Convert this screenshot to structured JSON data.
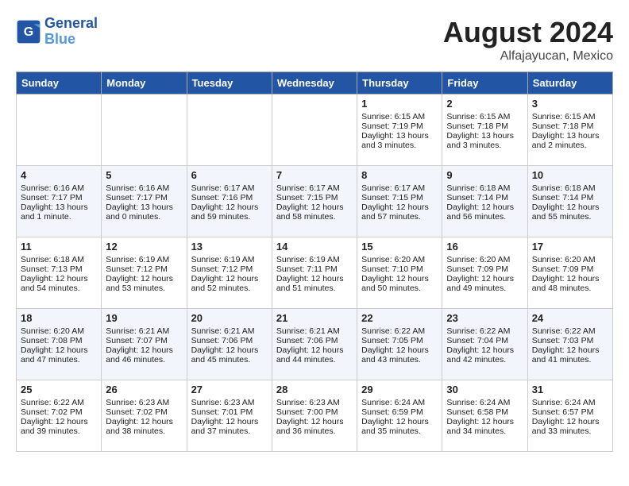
{
  "header": {
    "logo_line1": "General",
    "logo_line2": "Blue",
    "main_title": "August 2024",
    "subtitle": "Alfajayucan, Mexico"
  },
  "days_of_week": [
    "Sunday",
    "Monday",
    "Tuesday",
    "Wednesday",
    "Thursday",
    "Friday",
    "Saturday"
  ],
  "weeks": [
    [
      {
        "day": "",
        "info": ""
      },
      {
        "day": "",
        "info": ""
      },
      {
        "day": "",
        "info": ""
      },
      {
        "day": "",
        "info": ""
      },
      {
        "day": "1",
        "info": "Sunrise: 6:15 AM\nSunset: 7:19 PM\nDaylight: 13 hours\nand 3 minutes."
      },
      {
        "day": "2",
        "info": "Sunrise: 6:15 AM\nSunset: 7:18 PM\nDaylight: 13 hours\nand 3 minutes."
      },
      {
        "day": "3",
        "info": "Sunrise: 6:15 AM\nSunset: 7:18 PM\nDaylight: 13 hours\nand 2 minutes."
      }
    ],
    [
      {
        "day": "4",
        "info": "Sunrise: 6:16 AM\nSunset: 7:17 PM\nDaylight: 13 hours\nand 1 minute."
      },
      {
        "day": "5",
        "info": "Sunrise: 6:16 AM\nSunset: 7:17 PM\nDaylight: 13 hours\nand 0 minutes."
      },
      {
        "day": "6",
        "info": "Sunrise: 6:17 AM\nSunset: 7:16 PM\nDaylight: 12 hours\nand 59 minutes."
      },
      {
        "day": "7",
        "info": "Sunrise: 6:17 AM\nSunset: 7:15 PM\nDaylight: 12 hours\nand 58 minutes."
      },
      {
        "day": "8",
        "info": "Sunrise: 6:17 AM\nSunset: 7:15 PM\nDaylight: 12 hours\nand 57 minutes."
      },
      {
        "day": "9",
        "info": "Sunrise: 6:18 AM\nSunset: 7:14 PM\nDaylight: 12 hours\nand 56 minutes."
      },
      {
        "day": "10",
        "info": "Sunrise: 6:18 AM\nSunset: 7:14 PM\nDaylight: 12 hours\nand 55 minutes."
      }
    ],
    [
      {
        "day": "11",
        "info": "Sunrise: 6:18 AM\nSunset: 7:13 PM\nDaylight: 12 hours\nand 54 minutes."
      },
      {
        "day": "12",
        "info": "Sunrise: 6:19 AM\nSunset: 7:12 PM\nDaylight: 12 hours\nand 53 minutes."
      },
      {
        "day": "13",
        "info": "Sunrise: 6:19 AM\nSunset: 7:12 PM\nDaylight: 12 hours\nand 52 minutes."
      },
      {
        "day": "14",
        "info": "Sunrise: 6:19 AM\nSunset: 7:11 PM\nDaylight: 12 hours\nand 51 minutes."
      },
      {
        "day": "15",
        "info": "Sunrise: 6:20 AM\nSunset: 7:10 PM\nDaylight: 12 hours\nand 50 minutes."
      },
      {
        "day": "16",
        "info": "Sunrise: 6:20 AM\nSunset: 7:09 PM\nDaylight: 12 hours\nand 49 minutes."
      },
      {
        "day": "17",
        "info": "Sunrise: 6:20 AM\nSunset: 7:09 PM\nDaylight: 12 hours\nand 48 minutes."
      }
    ],
    [
      {
        "day": "18",
        "info": "Sunrise: 6:20 AM\nSunset: 7:08 PM\nDaylight: 12 hours\nand 47 minutes."
      },
      {
        "day": "19",
        "info": "Sunrise: 6:21 AM\nSunset: 7:07 PM\nDaylight: 12 hours\nand 46 minutes."
      },
      {
        "day": "20",
        "info": "Sunrise: 6:21 AM\nSunset: 7:06 PM\nDaylight: 12 hours\nand 45 minutes."
      },
      {
        "day": "21",
        "info": "Sunrise: 6:21 AM\nSunset: 7:06 PM\nDaylight: 12 hours\nand 44 minutes."
      },
      {
        "day": "22",
        "info": "Sunrise: 6:22 AM\nSunset: 7:05 PM\nDaylight: 12 hours\nand 43 minutes."
      },
      {
        "day": "23",
        "info": "Sunrise: 6:22 AM\nSunset: 7:04 PM\nDaylight: 12 hours\nand 42 minutes."
      },
      {
        "day": "24",
        "info": "Sunrise: 6:22 AM\nSunset: 7:03 PM\nDaylight: 12 hours\nand 41 minutes."
      }
    ],
    [
      {
        "day": "25",
        "info": "Sunrise: 6:22 AM\nSunset: 7:02 PM\nDaylight: 12 hours\nand 39 minutes."
      },
      {
        "day": "26",
        "info": "Sunrise: 6:23 AM\nSunset: 7:02 PM\nDaylight: 12 hours\nand 38 minutes."
      },
      {
        "day": "27",
        "info": "Sunrise: 6:23 AM\nSunset: 7:01 PM\nDaylight: 12 hours\nand 37 minutes."
      },
      {
        "day": "28",
        "info": "Sunrise: 6:23 AM\nSunset: 7:00 PM\nDaylight: 12 hours\nand 36 minutes."
      },
      {
        "day": "29",
        "info": "Sunrise: 6:24 AM\nSunset: 6:59 PM\nDaylight: 12 hours\nand 35 minutes."
      },
      {
        "day": "30",
        "info": "Sunrise: 6:24 AM\nSunset: 6:58 PM\nDaylight: 12 hours\nand 34 minutes."
      },
      {
        "day": "31",
        "info": "Sunrise: 6:24 AM\nSunset: 6:57 PM\nDaylight: 12 hours\nand 33 minutes."
      }
    ]
  ]
}
